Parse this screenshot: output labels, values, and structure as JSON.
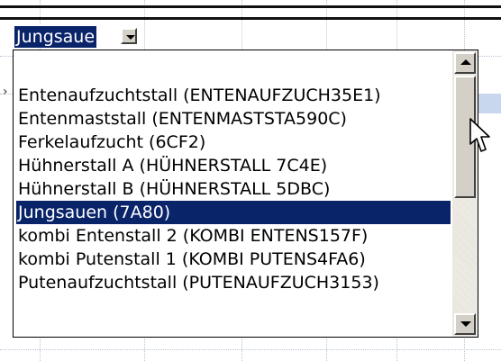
{
  "combo": {
    "value": "Jungsaue"
  },
  "dropdown": {
    "items": [
      {
        "label": "Entenaufzuchtstall (ENTENAUFZUCH35E1)",
        "selected": false
      },
      {
        "label": "Entenmaststall (ENTENMASTSTA590C)",
        "selected": false
      },
      {
        "label": "Ferkelaufzucht (6CF2)",
        "selected": false
      },
      {
        "label": "Hühnerstall A (HÜHNERSTALL 7C4E)",
        "selected": false
      },
      {
        "label": "Hühnerstall B (HÜHNERSTALL 5DBC)",
        "selected": false
      },
      {
        "label": "Jungsauen (7A80)",
        "selected": true
      },
      {
        "label": "kombi Entenstall 2 (KOMBI ENTENS157F)",
        "selected": false
      },
      {
        "label": "kombi Putenstall 1 (KOMBI PUTENS4FA6)",
        "selected": false
      },
      {
        "label": "Putenaufzuchtstall (PUTENAUFZUCH3153)",
        "selected": false
      }
    ],
    "selected_index": 5
  },
  "icons": {
    "combo_arrow": "chevron-down-icon",
    "scroll_up": "scroll-up-arrow-icon",
    "scroll_down": "scroll-down-arrow-icon",
    "cursor": "mouse-pointer-icon"
  },
  "colors": {
    "selection_bg": "#0a246a",
    "selection_text": "#ffffff",
    "face": "#d4d0c8",
    "grid": "#b9c4d6"
  }
}
